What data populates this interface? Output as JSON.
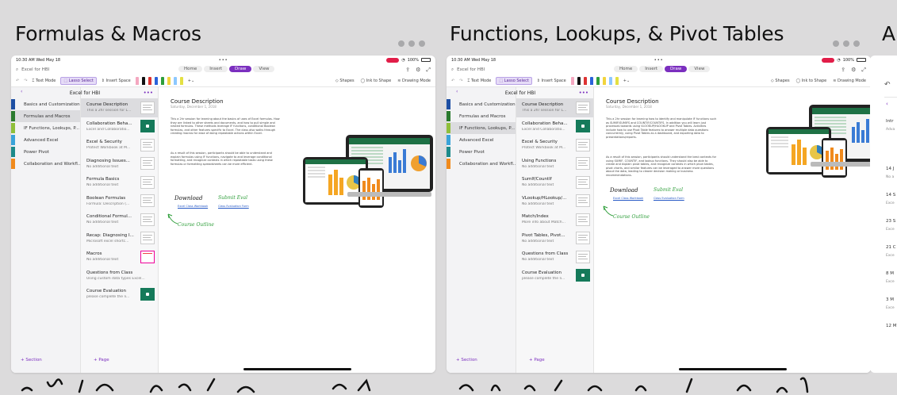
{
  "cards": [
    {
      "title": "Formulas & Macros",
      "status_time": "10:30 AM   Wed May 18",
      "battery": "100%",
      "search_placeholder": "Excel for HBI",
      "ribbon_tabs": [
        "Home",
        "Insert",
        "Draw",
        "View"
      ],
      "active_tab": "Draw",
      "toolbar": {
        "text_mode": "Text Mode",
        "lasso": "Lasso Select",
        "insert_space": "Insert Space",
        "shapes": "Shapes",
        "ink_to_shape": "Ink to Shape",
        "drawing_mode": "Drawing Mode"
      },
      "notebook_title": "Excel for HBI",
      "sections": [
        {
          "label": "Basics and Customization",
          "color": "#1d4fa3",
          "active": false
        },
        {
          "label": "Formulas and Macros",
          "color": "#2a7a2e",
          "active": true
        },
        {
          "label": "IF Functions, Lookups, P...",
          "color": "#8fbf3a",
          "active": false
        },
        {
          "label": "Advanced Excel",
          "color": "#3aa3d9",
          "active": false
        },
        {
          "label": "Power Pivot",
          "color": "#1d8a8a",
          "active": false
        },
        {
          "label": "Collaboration and Workfl...",
          "color": "#f08a1c",
          "active": false
        }
      ],
      "add_section": "+  Section",
      "add_page": "+  Page",
      "pages": [
        {
          "title": "Course Description",
          "sub": "This a 2hr session for L...",
          "thumb": "plain",
          "active": true
        },
        {
          "title": "Collaboration Beha...",
          "sub": "Excel and Collaboratio...",
          "thumb": "green",
          "active": false
        },
        {
          "title": "Excel & Security",
          "sub": "Protect Workbook at M...",
          "thumb": "plain",
          "active": false
        },
        {
          "title": "Diagnosing Issues...",
          "sub": "No additional text",
          "thumb": "plain",
          "active": false
        },
        {
          "title": "Formula Basics",
          "sub": "No additional text",
          "thumb": "plain",
          "active": false
        },
        {
          "title": "Boolean Formulas",
          "sub": "Formula: Description (...",
          "thumb": "plain",
          "active": false
        },
        {
          "title": "Conditional Formul...",
          "sub": "No additional text",
          "thumb": "plain",
          "active": false
        },
        {
          "title": "Recap: Diagnosing I...",
          "sub": "Microsoft excel shortc...",
          "thumb": "plain",
          "active": false
        },
        {
          "title": "Macros",
          "sub": "No additional text",
          "thumb": "red",
          "active": false
        },
        {
          "title": "Questions from Class",
          "sub": "Using custom data types Excel...",
          "thumb": "none",
          "active": false
        },
        {
          "title": "Course Evaluation",
          "sub": "please complete the li...",
          "thumb": "green",
          "active": false
        }
      ],
      "page_title": "Course Description",
      "page_date": "Saturday, December 1, 2018",
      "para1": "This a 2hr session for learning about the basics of uses of Excel formulas. How they are linked to other sheets and documents, and how to pull simple and nested formulas. These methods leverage IF functions, conditional Boolean formulas, and other features specific to Excel. The class also walks through creating macros for ease of doing repeatable actions within Excel.",
      "para2": "As a result of this session, participants should be able to understand and explain formulas using IF functions, navigate to and leverage conditional formatting, and recognize contexts in which repeatable tasks using these formulas or formatting spreadsheets can be more efficient.",
      "hw_download": "Download",
      "hw_submit": "Submit Eval",
      "hw_outline": "Course Outline",
      "link_workbook": "Excel Class Workbook",
      "link_eval": "Class Evaluation Form"
    },
    {
      "title": "Functions, Lookups, & Pivot Tables",
      "status_time": "10:30 AM   Wed May 18",
      "battery": "100%",
      "search_placeholder": "Excel for HBI",
      "ribbon_tabs": [
        "Home",
        "Insert",
        "Draw",
        "View"
      ],
      "active_tab": "Draw",
      "toolbar": {
        "text_mode": "Text Mode",
        "lasso": "Lasso Select",
        "insert_space": "Insert Space",
        "shapes": "Shapes",
        "ink_to_shape": "Ink to Shape",
        "drawing_mode": "Drawing Mode"
      },
      "notebook_title": "Excel for HBI",
      "sections": [
        {
          "label": "Basics and Customization",
          "color": "#1d4fa3",
          "active": false
        },
        {
          "label": "Formulas and Macros",
          "color": "#2a7a2e",
          "active": false
        },
        {
          "label": "IF Functions, Lookups, P...",
          "color": "#8fbf3a",
          "active": true
        },
        {
          "label": "Advanced Excel",
          "color": "#3aa3d9",
          "active": false
        },
        {
          "label": "Power Pivot",
          "color": "#1d8a8a",
          "active": false
        },
        {
          "label": "Collaboration and Workfl...",
          "color": "#f08a1c",
          "active": false
        }
      ],
      "add_section": "+  Section",
      "add_page": "+  Page",
      "pages": [
        {
          "title": "Course Description",
          "sub": "This a 2hr session for L...",
          "thumb": "plain",
          "active": true
        },
        {
          "title": "Collaboration Beha...",
          "sub": "Excel and Collaboratio...",
          "thumb": "green",
          "active": false
        },
        {
          "title": "Excel & Security",
          "sub": "Protect Workbook at M...",
          "thumb": "plain",
          "active": false
        },
        {
          "title": "Using Functions",
          "sub": "No additional text",
          "thumb": "plain",
          "active": false
        },
        {
          "title": "SumIf/CountIf",
          "sub": "No additional text",
          "thumb": "plain",
          "active": false
        },
        {
          "title": "VLookup/HLookup/...",
          "sub": "No additional text",
          "thumb": "plain",
          "active": false
        },
        {
          "title": "Match/Index",
          "sub": "More info about Match...",
          "thumb": "plain",
          "active": false
        },
        {
          "title": "Pivot Tables, Pivot...",
          "sub": "No additional text",
          "thumb": "plain",
          "active": false
        },
        {
          "title": "Questions from Class",
          "sub": "No additional text",
          "thumb": "plain",
          "active": false
        },
        {
          "title": "Course Evaluation",
          "sub": "please complete the li...",
          "thumb": "green",
          "active": false
        }
      ],
      "page_title": "Course Description",
      "page_date": "Saturday, December 1, 2018",
      "para1": "This a 2hr session for learning how to identify and manipulate IF functions such as SUMIF/SUMIFS and COUNTIF/COUNTIFS. In addition you will learn just processes towards using VLOOKUP/HLOOKUP and Pivot Tables. Activities include how to use Pivot Table features to answer multiple data questions concurrently, using Pivot Tables as a dashboard, and exporting data to presentations/reports.",
      "para2": "As a result of this session, participants should understand the best contexts for using SUMIF, COUNTIF, and lookup functions. They should also be able to create and explain pivot tables, and recognize contexts in which pivot tables, pivot charts, and similar features can be leveraged to answer more questions about the data, leading to clearer decision making or business recommendations.",
      "hw_download": "Download",
      "hw_submit": "Submit Eval",
      "hw_outline": "Course Outline",
      "link_workbook": "Excel Class Workbook",
      "link_eval": "Class Evaluation Form"
    }
  ],
  "peek": {
    "title": "A",
    "items": [
      {
        "label": "Intr",
        "sub": "Adva"
      },
      {
        "label": "14 J",
        "sub": "No a"
      },
      {
        "label": "14 S",
        "sub": "Exce"
      },
      {
        "label": "23 S",
        "sub": "Exce"
      },
      {
        "label": "21 C",
        "sub": "Exce"
      },
      {
        "label": "8 M",
        "sub": "Exce"
      },
      {
        "label": "3 M",
        "sub": "Exce"
      },
      {
        "label": "12 M",
        "sub": ""
      }
    ]
  },
  "colors": {
    "accent": "#7b2fbf",
    "link": "#2457c5",
    "handwriting_green": "#2e9e3a"
  }
}
